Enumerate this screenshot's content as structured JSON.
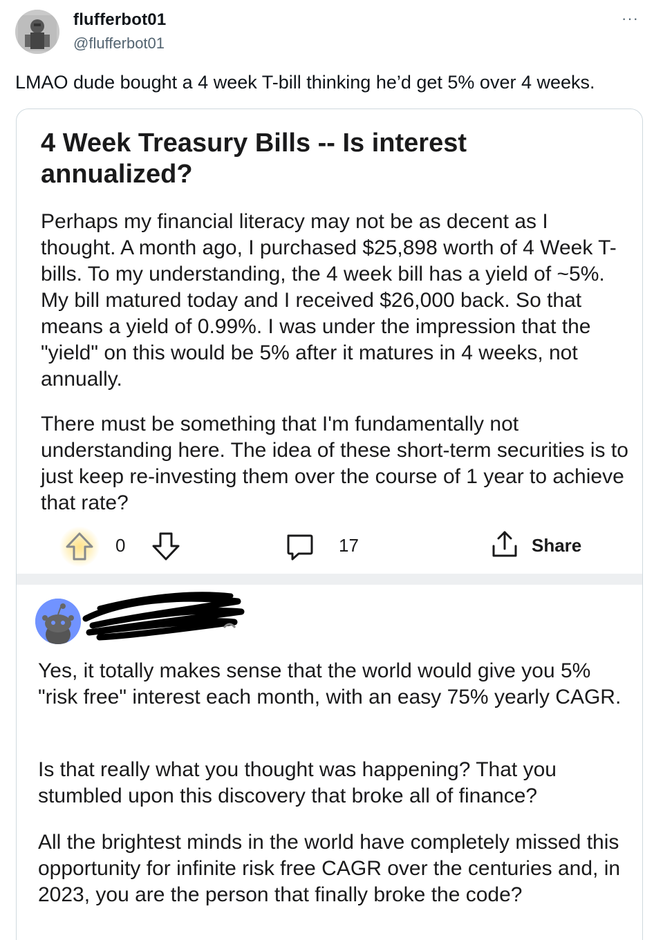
{
  "tweet": {
    "display_name": "flufferbot01",
    "handle": "@flufferbot01",
    "more_label": "···",
    "text": "LMAO dude bought a 4 week T-bill thinking he’d get 5% over 4 weeks."
  },
  "post": {
    "title": "4 Week Treasury Bills -- Is interest annualized?",
    "paragraphs": [
      "Perhaps my financial literacy may not be as decent as I thought. A month ago, I purchased $25,898 worth of 4 Week T-bills. To my understanding, the 4 week bill has a yield of ~5%. My bill matured today and I received $26,000 back. So that means a yield of 0.99%. I was under the impression that the \"yield\" on this would be 5% after it matures in 4 weeks, not annually.",
      "There must be something that I'm fundamentally not understanding here. The idea of these short-term securities is to just keep re-investing them over the course of 1 year to achieve that rate?"
    ],
    "vote_count": "0",
    "comment_count": "17",
    "share_label": "Share"
  },
  "comment": {
    "paragraphs": [
      "Yes, it totally makes sense that the world would give you 5% \"risk free\" interest each month, with an easy 75% yearly CAGR.",
      "Is that really what you thought was happening?  That you stumbled upon this discovery that broke all of finance?",
      "All the brightest minds in the world have completely missed this opportunity for infinite risk free CAGR over the centuries and, in 2023, you are the person that finally broke the code?"
    ]
  },
  "icons": {
    "avatar": "user-avatar",
    "upvote": "arrow-up-icon",
    "downvote": "arrow-down-icon",
    "comment": "speech-bubble-icon",
    "share": "share-upload-icon",
    "commenter_avatar": "reddit-snoo-avatar"
  },
  "colors": {
    "text_primary": "#0f1419",
    "text_secondary": "#536471",
    "card_border": "#cfd9de",
    "separator": "#edeff1",
    "snoo_blue": "#7193ff",
    "upvote_glow": "#ffe082"
  }
}
